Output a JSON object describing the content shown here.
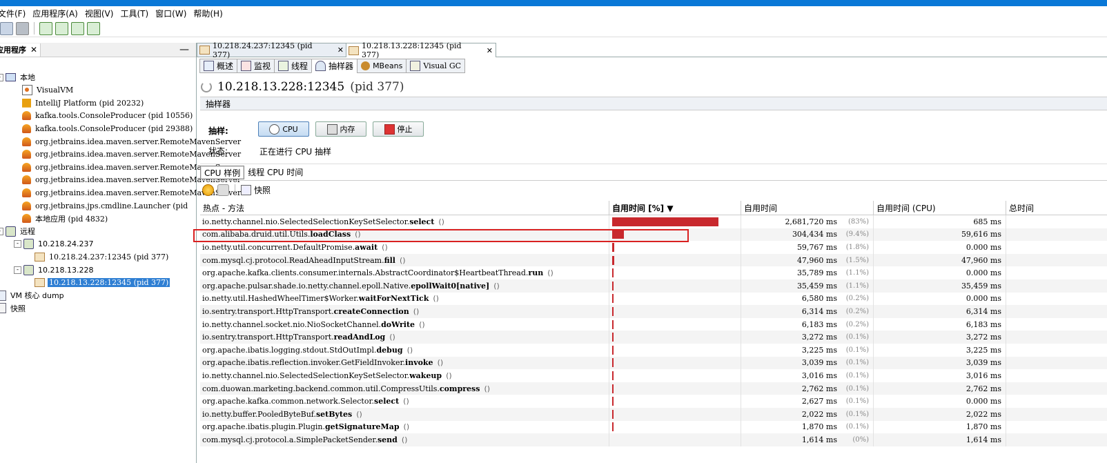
{
  "menu": [
    "文件(F)",
    "应用程序(A)",
    "视图(V)",
    "工具(T)",
    "窗口(W)",
    "帮助(H)"
  ],
  "left_panel": {
    "tab_title": "应用程序",
    "tree": [
      {
        "label": "本地",
        "icon": "computer-icon",
        "level": 0,
        "expander": "-"
      },
      {
        "label": "VisualVM",
        "icon": "visualvm-icon",
        "level": 1
      },
      {
        "label": "IntelliJ Platform (pid 20232)",
        "icon": "intellij-icon",
        "level": 1
      },
      {
        "label": "kafka.tools.ConsoleProducer (pid 10556)",
        "icon": "java-icon",
        "level": 1
      },
      {
        "label": "kafka.tools.ConsoleProducer (pid 29388)",
        "icon": "java-icon",
        "level": 1
      },
      {
        "label": "org.jetbrains.idea.maven.server.RemoteMavenServer",
        "icon": "java-icon",
        "level": 1
      },
      {
        "label": "org.jetbrains.idea.maven.server.RemoteMavenServer",
        "icon": "java-icon",
        "level": 1
      },
      {
        "label": "org.jetbrains.idea.maven.server.RemoteMavenServer",
        "icon": "java-icon",
        "level": 1
      },
      {
        "label": "org.jetbrains.idea.maven.server.RemoteMavenServer",
        "icon": "java-icon",
        "level": 1
      },
      {
        "label": "org.jetbrains.idea.maven.server.RemoteMavenServer",
        "icon": "java-icon",
        "level": 1
      },
      {
        "label": "org.jetbrains.jps.cmdline.Launcher (pid",
        "icon": "java-icon",
        "level": 1
      },
      {
        "label": "本地应用 (pid 4832)",
        "icon": "java-icon",
        "level": 1
      },
      {
        "label": "远程",
        "icon": "network-icon",
        "level": 0,
        "expander": "-"
      },
      {
        "label": "10.218.24.237",
        "icon": "remote-host-icon",
        "level": 1,
        "expander": "-"
      },
      {
        "label": "10.218.24.237:12345 (pid 377)",
        "icon": "jmx-icon",
        "level": 2
      },
      {
        "label": "10.218.13.228",
        "icon": "remote-host-icon",
        "level": 1,
        "expander": "-"
      },
      {
        "label": "10.218.13.228:12345 (pid 377)",
        "icon": "jmx-icon",
        "level": 2,
        "selected": true
      },
      {
        "label": "VM 核心 dump",
        "icon": "core-dump-icon",
        "level": 0
      },
      {
        "label": "快照",
        "icon": "snapshot-icon",
        "level": 0
      }
    ]
  },
  "doc_tabs": [
    {
      "label": "10.218.24.237:12345 (pid 377)",
      "active": false
    },
    {
      "label": "10.218.13.228:12345 (pid 377)",
      "active": true
    }
  ],
  "sub_tabs": [
    {
      "label": "概述",
      "icon": "overview-icon"
    },
    {
      "label": "监视",
      "icon": "monitor-icon"
    },
    {
      "label": "线程",
      "icon": "threads-icon"
    },
    {
      "label": "抽样器",
      "icon": "sampler-icon",
      "active": true
    },
    {
      "label": "MBeans",
      "icon": "mbeans-icon"
    },
    {
      "label": "Visual GC",
      "icon": "visualgc-icon"
    }
  ],
  "page": {
    "title": "10.218.13.228:12345",
    "pid": "(pid 377)",
    "section": "抽样器",
    "sample_label": "抽样:",
    "buttons": {
      "cpu": "CPU",
      "memory": "内存",
      "stop": "停止"
    },
    "status_label": "状态:",
    "status_value": "正在进行 CPU 抽样",
    "cpu_tabs": [
      "CPU 样例",
      "线程 CPU 时间"
    ],
    "snapshot_label": "快照"
  },
  "table": {
    "columns": [
      "热点 - 方法",
      "自用时间 [%] ▼",
      "自用时间",
      "自用时间 (CPU)",
      "总时间"
    ],
    "rows": [
      {
        "pkg": "io.netty.channel.nio.SelectedSelectionKeySetSelector.",
        "method": "select",
        "bar": 0.83,
        "self": "2,681,720 ms",
        "pct": "(83%)",
        "cpu": "685 ms"
      },
      {
        "pkg": "com.alibaba.druid.util.Utils.",
        "method": "loadClass",
        "bar": 0.094,
        "self": "304,434 ms",
        "pct": "(9.4%)",
        "cpu": "59,616 ms"
      },
      {
        "pkg": "io.netty.util.concurrent.DefaultPromise.",
        "method": "await",
        "bar": 0.018,
        "self": "59,767 ms",
        "pct": "(1.8%)",
        "cpu": "0.000 ms"
      },
      {
        "pkg": "com.mysql.cj.protocol.ReadAheadInputStream.",
        "method": "fill",
        "bar": 0.015,
        "self": "47,960 ms",
        "pct": "(1.5%)",
        "cpu": "47,960 ms"
      },
      {
        "pkg": "org.apache.kafka.clients.consumer.internals.AbstractCoordinator$HeartbeatThread.",
        "method": "run",
        "bar": 0.011,
        "self": "35,789 ms",
        "pct": "(1.1%)",
        "cpu": "0.000 ms"
      },
      {
        "pkg": "org.apache.pulsar.shade.io.netty.channel.epoll.Native.",
        "method": "epollWait0[native]",
        "bar": 0.011,
        "self": "35,459 ms",
        "pct": "(1.1%)",
        "cpu": "35,459 ms"
      },
      {
        "pkg": "io.netty.util.HashedWheelTimer$Worker.",
        "method": "waitForNextTick",
        "bar": 0.002,
        "self": "6,580 ms",
        "pct": "(0.2%)",
        "cpu": "0.000 ms"
      },
      {
        "pkg": "io.sentry.transport.HttpTransport.",
        "method": "createConnection",
        "bar": 0.002,
        "self": "6,314 ms",
        "pct": "(0.2%)",
        "cpu": "6,314 ms"
      },
      {
        "pkg": "io.netty.channel.socket.nio.NioSocketChannel.",
        "method": "doWrite",
        "bar": 0.002,
        "self": "6,183 ms",
        "pct": "(0.2%)",
        "cpu": "6,183 ms"
      },
      {
        "pkg": "io.sentry.transport.HttpTransport.",
        "method": "readAndLog",
        "bar": 0.001,
        "self": "3,272 ms",
        "pct": "(0.1%)",
        "cpu": "3,272 ms"
      },
      {
        "pkg": "org.apache.ibatis.logging.stdout.StdOutImpl.",
        "method": "debug",
        "bar": 0.001,
        "self": "3,225 ms",
        "pct": "(0.1%)",
        "cpu": "3,225 ms"
      },
      {
        "pkg": "org.apache.ibatis.reflection.invoker.GetFieldInvoker.",
        "method": "invoke",
        "bar": 0.001,
        "self": "3,039 ms",
        "pct": "(0.1%)",
        "cpu": "3,039 ms"
      },
      {
        "pkg": "io.netty.channel.nio.SelectedSelectionKeySetSelector.",
        "method": "wakeup",
        "bar": 0.001,
        "self": "3,016 ms",
        "pct": "(0.1%)",
        "cpu": "3,016 ms"
      },
      {
        "pkg": "com.duowan.marketing.backend.common.util.CompressUtils.",
        "method": "compress",
        "bar": 0.001,
        "self": "2,762 ms",
        "pct": "(0.1%)",
        "cpu": "2,762 ms"
      },
      {
        "pkg": "org.apache.kafka.common.network.Selector.",
        "method": "select",
        "bar": 0.001,
        "self": "2,627 ms",
        "pct": "(0.1%)",
        "cpu": "0.000 ms"
      },
      {
        "pkg": "io.netty.buffer.PooledByteBuf.",
        "method": "setBytes",
        "bar": 0.001,
        "self": "2,022 ms",
        "pct": "(0.1%)",
        "cpu": "2,022 ms"
      },
      {
        "pkg": "org.apache.ibatis.plugin.Plugin.",
        "method": "getSignatureMap",
        "bar": 0.001,
        "self": "1,870 ms",
        "pct": "(0.1%)",
        "cpu": "1,870 ms"
      },
      {
        "pkg": "com.mysql.cj.protocol.a.SimplePacketSender.",
        "method": "send",
        "bar": 0.0,
        "self": "1,614 ms",
        "pct": "(0%)",
        "cpu": "1,614 ms"
      }
    ],
    "highlighted_row": 1
  },
  "colors": {
    "bar": "#c8282d",
    "selection": "#2f7fd3",
    "highlight_box": "#d92020",
    "titlebar": "#0a78d7"
  }
}
